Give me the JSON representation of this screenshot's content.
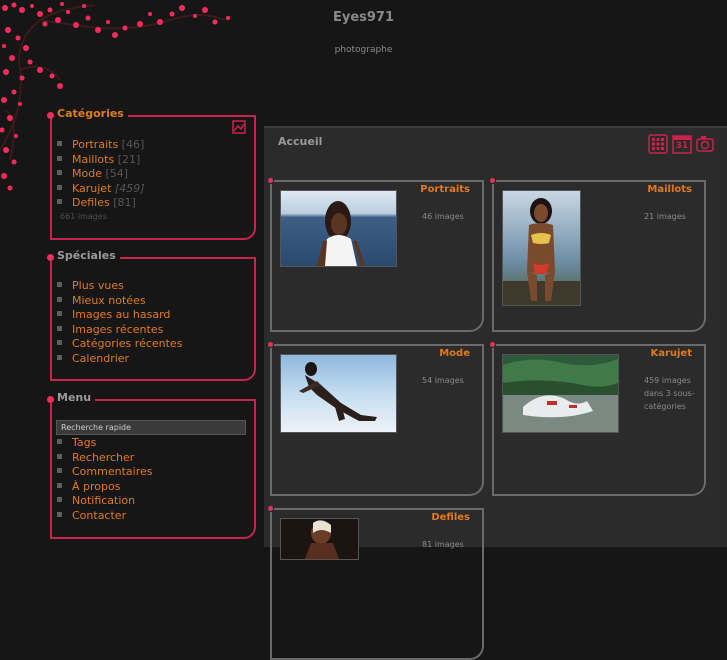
{
  "header": {
    "title": "Eyes971",
    "subtitle": "photographe"
  },
  "colors": {
    "accent": "#c8234d",
    "link": "#e07a1f",
    "blossom": "#ff2a5c",
    "background": "#161616"
  },
  "categories_box": {
    "title": "Catégories",
    "icon": "image-icon",
    "items": [
      {
        "label": "Portraits",
        "count": "[46]"
      },
      {
        "label": "Maillots",
        "count": "[21]"
      },
      {
        "label": "Mode",
        "count": "[54]"
      },
      {
        "label": "Karujet",
        "count": "[459]"
      },
      {
        "label": "Defiles",
        "count": "[81]"
      }
    ],
    "total": "661 images"
  },
  "specials_box": {
    "title": "Spéciales",
    "items": [
      "Plus vues",
      "Mieux notées",
      "Images au hasard",
      "Images récentes",
      "Catégories récentes",
      "Calendrier"
    ]
  },
  "menu_box": {
    "title": "Menu",
    "search_placeholder": "Recherche rapide",
    "items": [
      "Tags",
      "Rechercher",
      "Commentaires",
      "À propos",
      "Notification",
      "Contacter"
    ]
  },
  "main": {
    "title": "Accueil",
    "toolbar_icons": [
      "grid-view-icon",
      "calendar-icon",
      "camera-icon"
    ],
    "calendar_day": "31",
    "cards": [
      {
        "name": "Portraits",
        "info": "46 images"
      },
      {
        "name": "Maillots",
        "info": "21 images"
      },
      {
        "name": "Mode",
        "info": "54 images"
      },
      {
        "name": "Karujet",
        "info": "459 images dans 3 sous-catégories"
      },
      {
        "name": "Defiles",
        "info": "81 images"
      }
    ]
  }
}
